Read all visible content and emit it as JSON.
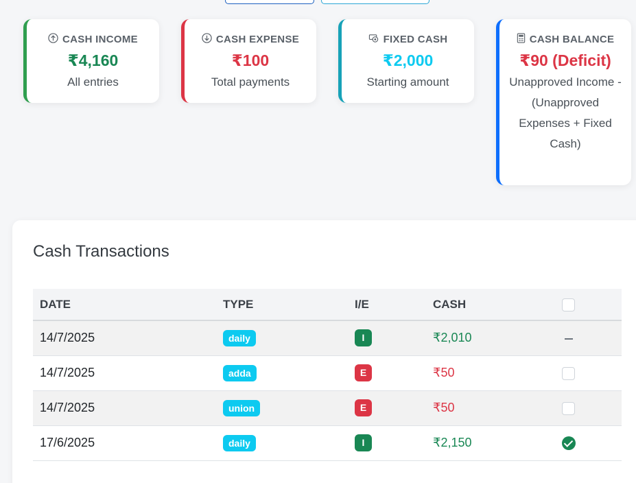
{
  "cards": {
    "income": {
      "title": "CASH INCOME",
      "value": "₹4,160",
      "sub": "All entries",
      "icon": "arrow-up-circle-icon",
      "color": "#198754"
    },
    "expense": {
      "title": "CASH EXPENSE",
      "value": "₹100",
      "sub": "Total payments",
      "icon": "arrow-down-circle-icon",
      "color": "#dc3545"
    },
    "fixed": {
      "title": "FIXED CASH",
      "value": "₹2,000",
      "sub": "Starting amount",
      "icon": "cash-icon",
      "color": "#0dcaf0"
    },
    "balance": {
      "title": "CASH BALANCE",
      "value": "₹90 (Deficit)",
      "sub": "Unapproved Income - (Unapproved Expenses + Fixed Cash)",
      "icon": "calculator-icon",
      "color": "#dc3545"
    }
  },
  "transactions": {
    "title": "Cash Transactions",
    "columns": {
      "date": "DATE",
      "type": "TYPE",
      "ie": "I/E",
      "cash": "CASH"
    },
    "rows": [
      {
        "date": "14/7/2025",
        "type": "daily",
        "ie": "I",
        "cash": "₹2,010",
        "status": "indeterminate"
      },
      {
        "date": "14/7/2025",
        "type": "adda",
        "ie": "E",
        "cash": "₹50",
        "status": "unchecked"
      },
      {
        "date": "14/7/2025",
        "type": "union",
        "ie": "E",
        "cash": "₹50",
        "status": "unchecked"
      },
      {
        "date": "17/6/2025",
        "type": "daily",
        "ie": "I",
        "cash": "₹2,150",
        "status": "approved"
      }
    ]
  }
}
